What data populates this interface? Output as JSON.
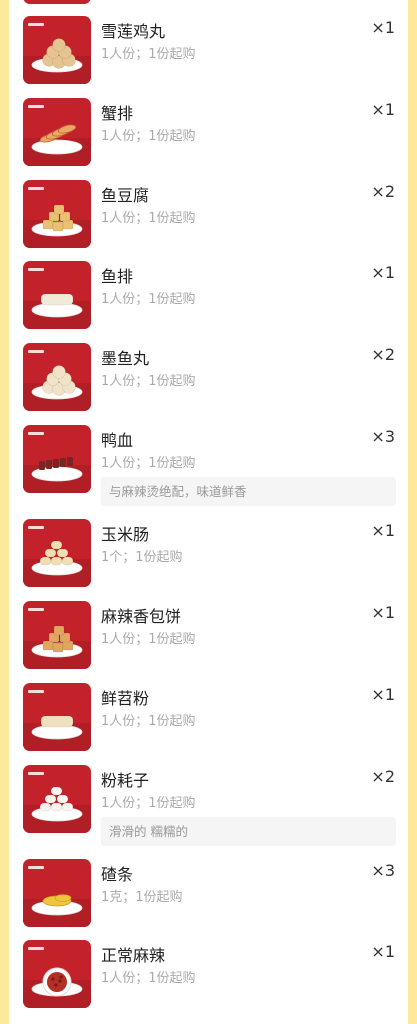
{
  "items": [
    {
      "name": "雪莲鸡丸",
      "desc": "1人份；1份起购",
      "qty": "×1",
      "food": "balls",
      "food_color": "#e6c48f",
      "note": ""
    },
    {
      "name": "蟹排",
      "desc": "1人份；1份起购",
      "qty": "×1",
      "food": "crab",
      "food_color": "#e8a868",
      "note": ""
    },
    {
      "name": "鱼豆腐",
      "desc": "1人份；1份起购",
      "qty": "×2",
      "food": "cubes",
      "food_color": "#ebc073",
      "note": ""
    },
    {
      "name": "鱼排",
      "desc": "1人份；1份起购",
      "qty": "×1",
      "food": "slab",
      "food_color": "#f2ead8",
      "note": ""
    },
    {
      "name": "墨鱼丸",
      "desc": "1人份；1份起购",
      "qty": "×2",
      "food": "balls",
      "food_color": "#f0e3c8",
      "note": ""
    },
    {
      "name": "鸭血",
      "desc": "1人份；1份起购",
      "qty": "×3",
      "food": "blood",
      "food_color": "#7a2424",
      "note": "与麻辣烫绝配，味道鲜香"
    },
    {
      "name": "玉米肠",
      "desc": "1个；1份起购",
      "qty": "×1",
      "food": "rolls",
      "food_color": "#f1dfb4",
      "note": ""
    },
    {
      "name": "麻辣香包饼",
      "desc": "1人份；1份起购",
      "qty": "×1",
      "food": "cubes",
      "food_color": "#e2a660",
      "note": ""
    },
    {
      "name": "鲜苕粉",
      "desc": "1人份；1份起购",
      "qty": "×1",
      "food": "slab",
      "food_color": "#efe1bd",
      "note": ""
    },
    {
      "name": "粉耗子",
      "desc": "1人份；1份起购",
      "qty": "×2",
      "food": "rolls",
      "food_color": "#f8f6ef",
      "note": "滑滑的 糯糯的"
    },
    {
      "name": "碴条",
      "desc": "1克；1份起购",
      "qty": "×3",
      "food": "flat",
      "food_color": "#eec53d",
      "note": ""
    },
    {
      "name": "正常麻辣",
      "desc": "1人份；1份起购",
      "qty": "×1",
      "food": "bowl",
      "food_color": "#b33025",
      "note": ""
    }
  ],
  "colors": {
    "background": "#fce99a",
    "thumb_red": "#c4222b",
    "plate": "#ffffff"
  }
}
